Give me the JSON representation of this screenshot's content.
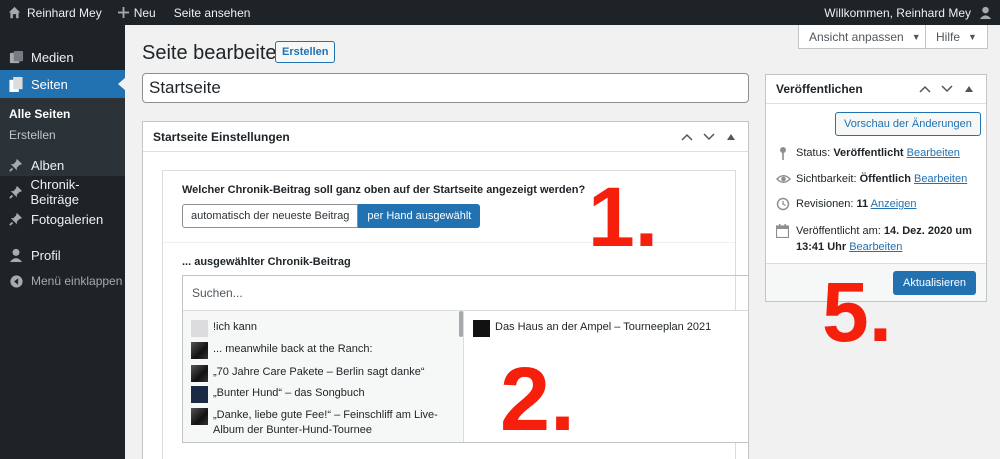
{
  "adminbar": {
    "site_name": "Reinhard Mey",
    "new_label": "Neu",
    "view_page": "Seite ansehen",
    "greeting": "Willkommen, Reinhard Mey"
  },
  "sidebar": {
    "items": [
      {
        "label": "Medien",
        "icon": "media-icon"
      },
      {
        "label": "Seiten",
        "icon": "pages-icon"
      },
      {
        "label": "Alben",
        "icon": "pin-icon"
      },
      {
        "label": "Chronik-Beiträge",
        "icon": "pin-icon"
      },
      {
        "label": "Fotogalerien",
        "icon": "pin-icon"
      },
      {
        "label": "Profil",
        "icon": "user-icon"
      },
      {
        "label": "Menü einklappen",
        "icon": "collapse-icon"
      }
    ],
    "submenu": [
      "Alle Seiten",
      "Erstellen"
    ]
  },
  "screen_options": {
    "label": "Ansicht anpassen",
    "help": "Hilfe"
  },
  "header": {
    "title": "Seite bearbeiten",
    "add_new": "Erstellen"
  },
  "post_title": "Startseite",
  "settings": {
    "title": "Startseite Einstellungen",
    "question": "Welcher Chronik-Beitrag soll ganz oben auf der Startseite angezeigt werden?",
    "options": [
      "automatisch der neueste Beitrag",
      "per Hand ausgewählt"
    ],
    "selected_option": "per Hand ausgewählt",
    "selected_label": "... ausgewählter Chronik-Beitrag",
    "search_placeholder": "Suchen...",
    "available": [
      "!ich kann",
      "... meanwhile back at the Ranch:",
      "„70 Jahre Care Pakete – Berlin sagt danke“",
      "„Bunter Hund“ – das Songbuch",
      "„Danke, liebe gute Fee!“ – Feinschliff am Live-Album der Bunter-Hund-Tournee"
    ],
    "selected": [
      "Das Haus an der Ampel – Tourneeplan 2021"
    ]
  },
  "publish": {
    "title": "Veröffentlichen",
    "preview": "Vorschau der Änderungen",
    "status_label": "Status:",
    "status_value": "Veröffentlicht",
    "visibility_label": "Sichtbarkeit:",
    "visibility_value": "Öffentlich",
    "revisions_label": "Revisionen:",
    "revisions_value": "11",
    "revisions_link": "Anzeigen",
    "published_label": "Veröffentlicht am:",
    "published_date_line1": "14. Dez. 2020 um",
    "published_date_line2": "13:41 Uhr",
    "edit": "Bearbeiten",
    "update": "Aktualisieren"
  },
  "annotations": [
    "1.",
    "2.",
    "5."
  ],
  "colors": {
    "accent": "#2271b1",
    "annotation": "#f51f0c",
    "sidebar": "#1d2327"
  }
}
